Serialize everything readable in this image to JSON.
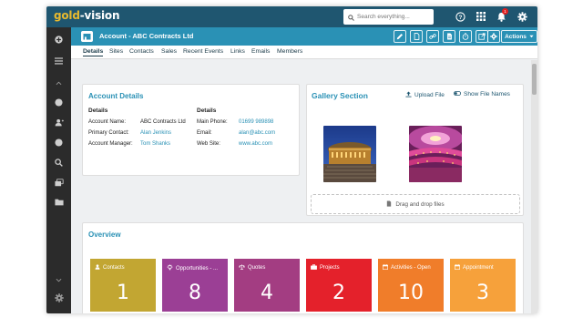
{
  "app": {
    "logo_part1": "gold",
    "logo_part2": "-vision",
    "search_placeholder": "Search everything...",
    "notification_count": "1"
  },
  "record": {
    "title": "Account - ABC Contracts Ltd",
    "actions_label": "Actions"
  },
  "tabs": [
    "Details",
    "Sites",
    "Contacts",
    "Sales",
    "Recent Events",
    "Links",
    "Emails",
    "Members"
  ],
  "account_details": {
    "title": "Account Details",
    "left_heading": "Details",
    "right_heading": "Details",
    "left_fields": [
      {
        "label": "Account Name:",
        "value": "ABC Contracts Ltd"
      },
      {
        "label": "Primary Contact:",
        "value": "Alan Jenkins"
      },
      {
        "label": "Account Manager:",
        "value": "Tom Shanks"
      }
    ],
    "right_fields": [
      {
        "label": "Main Phone:",
        "value": "01699 989898"
      },
      {
        "label": "Email:",
        "value": "alan@abc.com"
      },
      {
        "label": "Web Site:",
        "value": "www.abc.com"
      }
    ]
  },
  "gallery": {
    "title": "Gallery Section",
    "upload_label": "Upload File",
    "show_names_label": "Show File Names",
    "drop_label": "Drag and drop files"
  },
  "overview": {
    "title": "Overview",
    "tiles": [
      {
        "label": "Contacts",
        "count": "1",
        "color": "#c2a632",
        "icon": "person-icon"
      },
      {
        "label": "Opportunities - ...",
        "count": "8",
        "color": "#9b3f95",
        "icon": "lightbulb-icon"
      },
      {
        "label": "Quotes",
        "count": "4",
        "color": "#a33d82",
        "icon": "scales-icon"
      },
      {
        "label": "Projects",
        "count": "2",
        "color": "#e4212b",
        "icon": "briefcase-icon"
      },
      {
        "label": "Activities - Open",
        "count": "10",
        "color": "#f07d2a",
        "icon": "calendar-icon"
      },
      {
        "label": "Appointment",
        "count": "3",
        "color": "#f6a13b",
        "icon": "calendar-icon"
      }
    ]
  }
}
